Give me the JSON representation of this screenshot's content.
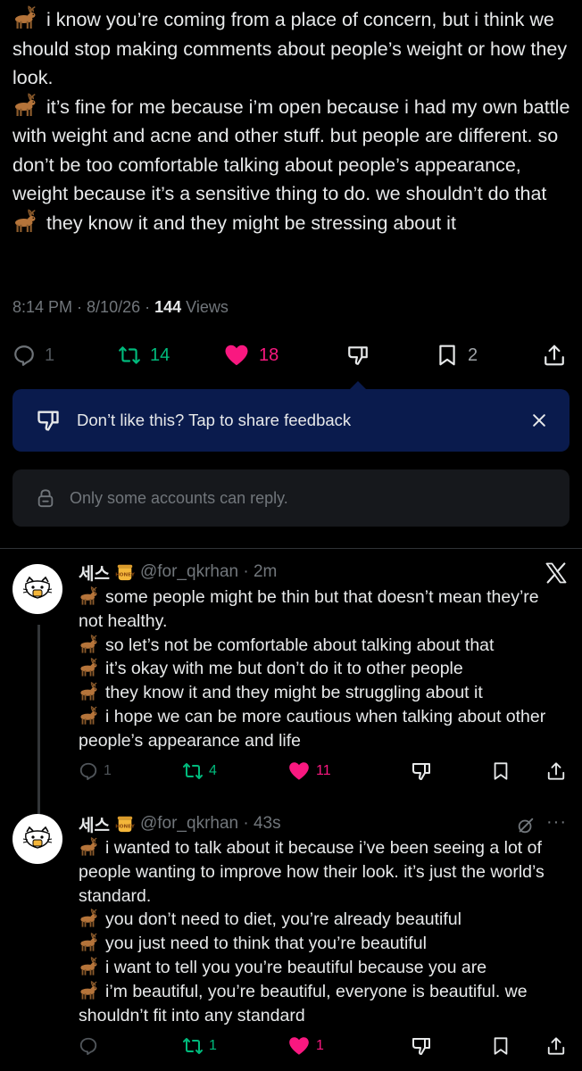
{
  "main_tweet": {
    "lines": [
      "i know you’re coming from a place of concern, but i think we should stop making comments about people’s weight or how they look.",
      "it’s fine for me because i’m open because i had my own battle with weight and acne and other stuff. but people are different. so don’t be too comfortable talking about people’s appearance, weight because it’s a sensitive thing to do. we shouldn’t do that",
      "they know it and they might be stressing about it"
    ],
    "time": "8:14 PM",
    "date": "8/10/26",
    "views_count": "144",
    "views_label": "Views",
    "replies": "1",
    "retweets": "14",
    "likes": "18",
    "bookmarks": "2"
  },
  "feedback_banner": {
    "text": "Don’t like this? Tap to share feedback"
  },
  "reply_restriction": {
    "text": "Only some accounts can reply."
  },
  "replies": [
    {
      "name": "세스",
      "handle": "@for_qkrhan",
      "time": "2m",
      "lines": [
        "some people might be thin but that doesn’t mean they’re not healthy.",
        "so let’s not be comfortable about talking about that",
        "it’s okay with me but don’t do it to other people",
        "they know it and they might be struggling about it",
        "i hope we can be more cautious when talking about other people’s appearance and life"
      ],
      "replies": "1",
      "retweets": "4",
      "likes": "11"
    },
    {
      "name": "세스",
      "handle": "@for_qkrhan",
      "time": "43s",
      "lines": [
        "i wanted to talk about it because i’ve been seeing a lot of people wanting to improve how their look. it’s just the world’s standard.",
        "you don’t need to diet, you’re already beautiful",
        "you just need to think that you’re beautiful",
        "i want to tell you you’re beautiful because you are",
        "i’m beautiful, you’re beautiful, everyone is beautiful. we shouldn’t fit into any standard"
      ],
      "replies": "",
      "retweets": "1",
      "likes": "1"
    }
  ],
  "icons": [
    "deer-emoji",
    "honey-pot-emoji",
    "reply-icon",
    "retweet-icon",
    "like-icon",
    "dislike-icon",
    "bookmark-icon",
    "share-icon",
    "close-icon",
    "lock-icon",
    "x-logo-icon",
    "edit-icon",
    "more-icon"
  ],
  "colors": {
    "background": "#000000",
    "text": "#e7e9ea",
    "muted": "#71767b",
    "retweet": "#00ba7c",
    "like": "#f91880",
    "banner": "#0a1b4d"
  }
}
